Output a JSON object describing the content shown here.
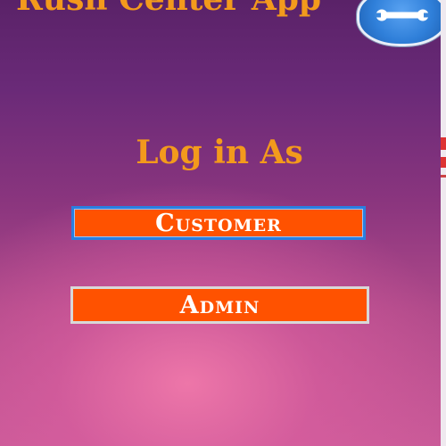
{
  "app": {
    "title": "Rush Center App"
  },
  "header": {
    "settings_icon": "wrench-icon"
  },
  "login": {
    "heading": "Log in As",
    "customer_label": "Customer",
    "admin_label": "Admin"
  },
  "colors": {
    "title": "#f39a1c",
    "button_fill": "#ff5200",
    "button_text": "#ffffff",
    "background_top": "#5a2268",
    "background_bottom": "#c95a98"
  }
}
